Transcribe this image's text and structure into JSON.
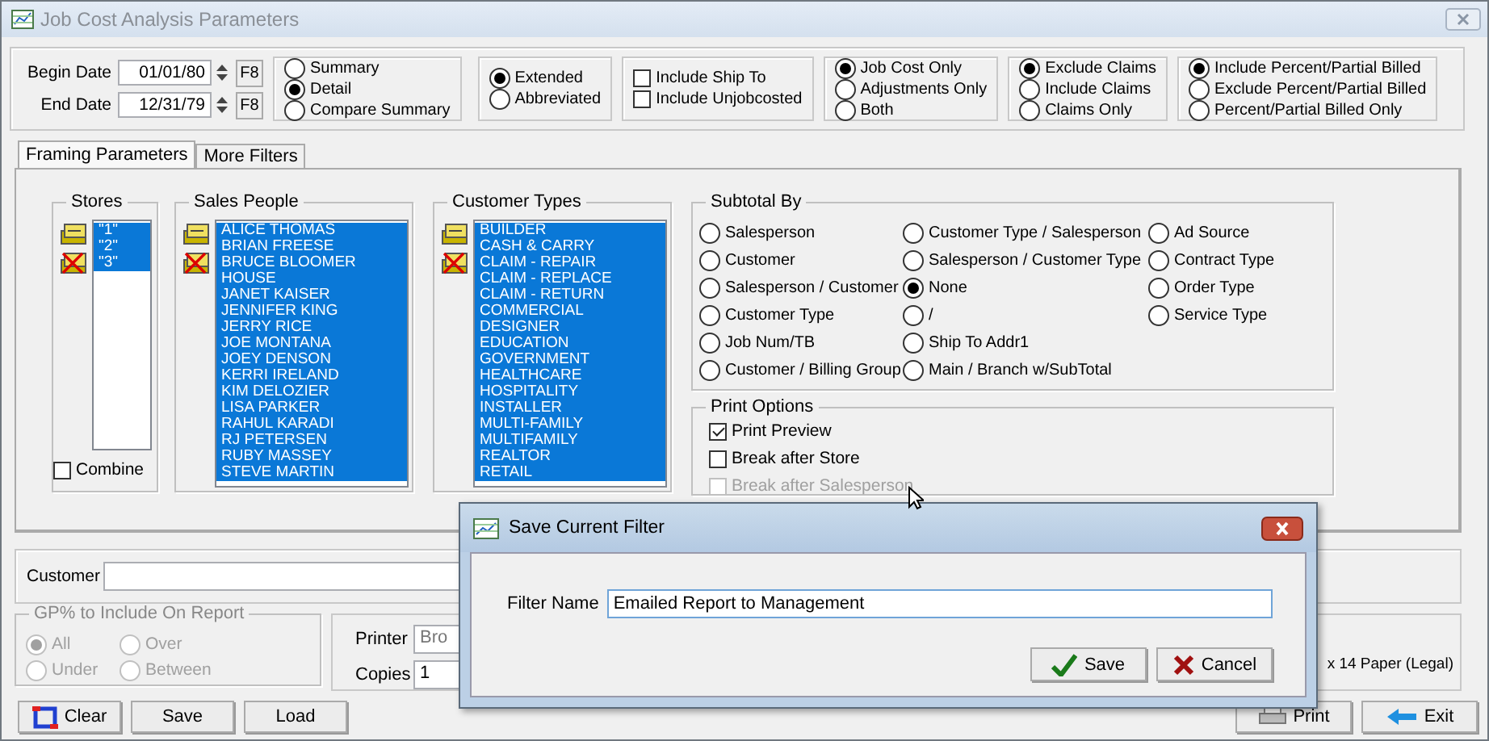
{
  "window": {
    "title": "Job Cost Analysis Parameters"
  },
  "dates": [
    {
      "label": "Begin Date",
      "value": "01/01/80",
      "button": "F8"
    },
    {
      "label": "End Date",
      "value": "12/31/79",
      "button": "F8"
    }
  ],
  "option_groups": [
    {
      "kind": "radio",
      "items": [
        {
          "label": "Summary",
          "selected": false
        },
        {
          "label": "Detail",
          "selected": true
        },
        {
          "label": "Compare Summary",
          "selected": false
        }
      ]
    },
    {
      "kind": "radio",
      "items": [
        {
          "label": "Extended",
          "selected": true
        },
        {
          "label": "Abbreviated",
          "selected": false
        }
      ]
    },
    {
      "kind": "checkbox",
      "items": [
        {
          "label": "Include Ship To",
          "checked": false
        },
        {
          "label": "Include Unjobcosted",
          "checked": false
        }
      ]
    },
    {
      "kind": "radio",
      "items": [
        {
          "label": "Job Cost Only",
          "selected": true
        },
        {
          "label": "Adjustments Only",
          "selected": false
        },
        {
          "label": "Both",
          "selected": false
        }
      ]
    },
    {
      "kind": "radio",
      "items": [
        {
          "label": "Exclude Claims",
          "selected": true
        },
        {
          "label": "Include Claims",
          "selected": false
        },
        {
          "label": "Claims Only",
          "selected": false
        }
      ]
    },
    {
      "kind": "radio",
      "items": [
        {
          "label": "Include Percent/Partial Billed",
          "selected": true
        },
        {
          "label": "Exclude Percent/Partial Billed",
          "selected": false
        },
        {
          "label": "Percent/Partial Billed Only",
          "selected": false
        }
      ]
    }
  ],
  "tabs": [
    {
      "label": "Framing Parameters",
      "selected": true
    },
    {
      "label": "More Filters",
      "selected": false
    }
  ],
  "lists": [
    {
      "title": "Stores",
      "items": [
        {
          "label": "\"1\"",
          "selected": true
        },
        {
          "label": "\"2\"",
          "selected": true
        },
        {
          "label": "\"3\"",
          "selected": true
        }
      ]
    },
    {
      "title": "Sales People",
      "items": [
        {
          "label": "ALICE THOMAS",
          "selected": true
        },
        {
          "label": "BRIAN FREESE",
          "selected": true
        },
        {
          "label": "BRUCE BLOOMER",
          "selected": true
        },
        {
          "label": "HOUSE",
          "selected": true
        },
        {
          "label": "JANET KAISER",
          "selected": true
        },
        {
          "label": "JENNIFER KING",
          "selected": true
        },
        {
          "label": "JERRY RICE",
          "selected": true
        },
        {
          "label": "JOE MONTANA",
          "selected": true
        },
        {
          "label": "JOEY DENSON",
          "selected": true
        },
        {
          "label": "KERRI IRELAND",
          "selected": true
        },
        {
          "label": "KIM DELOZIER",
          "selected": true
        },
        {
          "label": "LISA PARKER",
          "selected": true
        },
        {
          "label": "RAHUL KARADI",
          "selected": true
        },
        {
          "label": "RJ PETERSEN",
          "selected": true
        },
        {
          "label": "RUBY MASSEY",
          "selected": true
        },
        {
          "label": "STEVE MARTIN",
          "selected": true
        }
      ]
    },
    {
      "title": "Customer Types",
      "items": [
        {
          "label": "BUILDER",
          "selected": true
        },
        {
          "label": "CASH & CARRY",
          "selected": true
        },
        {
          "label": "CLAIM - REPAIR",
          "selected": true
        },
        {
          "label": "CLAIM - REPLACE",
          "selected": true
        },
        {
          "label": "CLAIM - RETURN",
          "selected": true
        },
        {
          "label": "COMMERCIAL",
          "selected": true
        },
        {
          "label": "DESIGNER",
          "selected": true
        },
        {
          "label": "EDUCATION",
          "selected": true
        },
        {
          "label": "GOVERNMENT",
          "selected": true
        },
        {
          "label": "HEALTHCARE",
          "selected": true
        },
        {
          "label": "HOSPITALITY",
          "selected": true
        },
        {
          "label": "INSTALLER",
          "selected": true
        },
        {
          "label": "MULTI-FAMILY",
          "selected": true
        },
        {
          "label": "MULTIFAMILY",
          "selected": true
        },
        {
          "label": "REALTOR",
          "selected": true
        },
        {
          "label": "RETAIL",
          "selected": true
        }
      ]
    }
  ],
  "combine": {
    "label": "Combine",
    "checked": false
  },
  "subtotal_by": {
    "title": "Subtotal By",
    "columns": [
      [
        {
          "label": "Salesperson",
          "selected": false
        },
        {
          "label": "Customer",
          "selected": false
        },
        {
          "label": "Salesperson / Customer",
          "selected": false
        },
        {
          "label": "Customer Type",
          "selected": false
        },
        {
          "label": "Job Num/TB",
          "selected": false
        },
        {
          "label": "Customer / Billing Group",
          "selected": false
        }
      ],
      [
        {
          "label": "Customer Type / Salesperson",
          "selected": false
        },
        {
          "label": "Salesperson / Customer Type",
          "selected": false
        },
        {
          "label": "None",
          "selected": true
        },
        {
          "label": "/",
          "selected": false
        },
        {
          "label": "Ship To Addr1",
          "selected": false
        },
        {
          "label": "Main / Branch w/SubTotal",
          "selected": false
        }
      ],
      [
        {
          "label": "Ad Source",
          "selected": false
        },
        {
          "label": "Contract Type",
          "selected": false
        },
        {
          "label": "Order Type",
          "selected": false
        },
        {
          "label": "Service Type",
          "selected": false
        }
      ]
    ]
  },
  "print_options": {
    "title": "Print Options",
    "items": [
      {
        "label": "Print Preview",
        "checked": true,
        "disabled": false
      },
      {
        "label": "Break after Store",
        "checked": false,
        "disabled": false
      },
      {
        "label": "Break after Salesperson",
        "checked": false,
        "disabled": true
      }
    ]
  },
  "customer": {
    "label": "Customer"
  },
  "gp": {
    "title": "GP% to Include On Report",
    "items": [
      {
        "label": "All",
        "selected": true
      },
      {
        "label": "Over",
        "selected": false
      },
      {
        "label": "Under",
        "selected": false
      },
      {
        "label": "Between",
        "selected": false
      }
    ]
  },
  "printer": {
    "printer_label": "Printer",
    "printer_value": "Bro",
    "copies_label": "Copies",
    "copies_value": "1",
    "paper": "x 14 Paper (Legal)"
  },
  "left_buttons": [
    {
      "label": "Clear",
      "kind": "clear"
    },
    {
      "label": "Save",
      "kind": "plain"
    },
    {
      "label": "Load",
      "kind": "plain"
    }
  ],
  "right_buttons": [
    {
      "label": "Print",
      "kind": "print"
    },
    {
      "label": "Exit",
      "kind": "exit"
    }
  ],
  "dialog": {
    "title": "Save Current Filter",
    "field_label": "Filter Name",
    "value": "Emailed Report to Management",
    "buttons": [
      {
        "label": "Save",
        "kind": "ok"
      },
      {
        "label": "Cancel",
        "kind": "cancel"
      }
    ]
  }
}
